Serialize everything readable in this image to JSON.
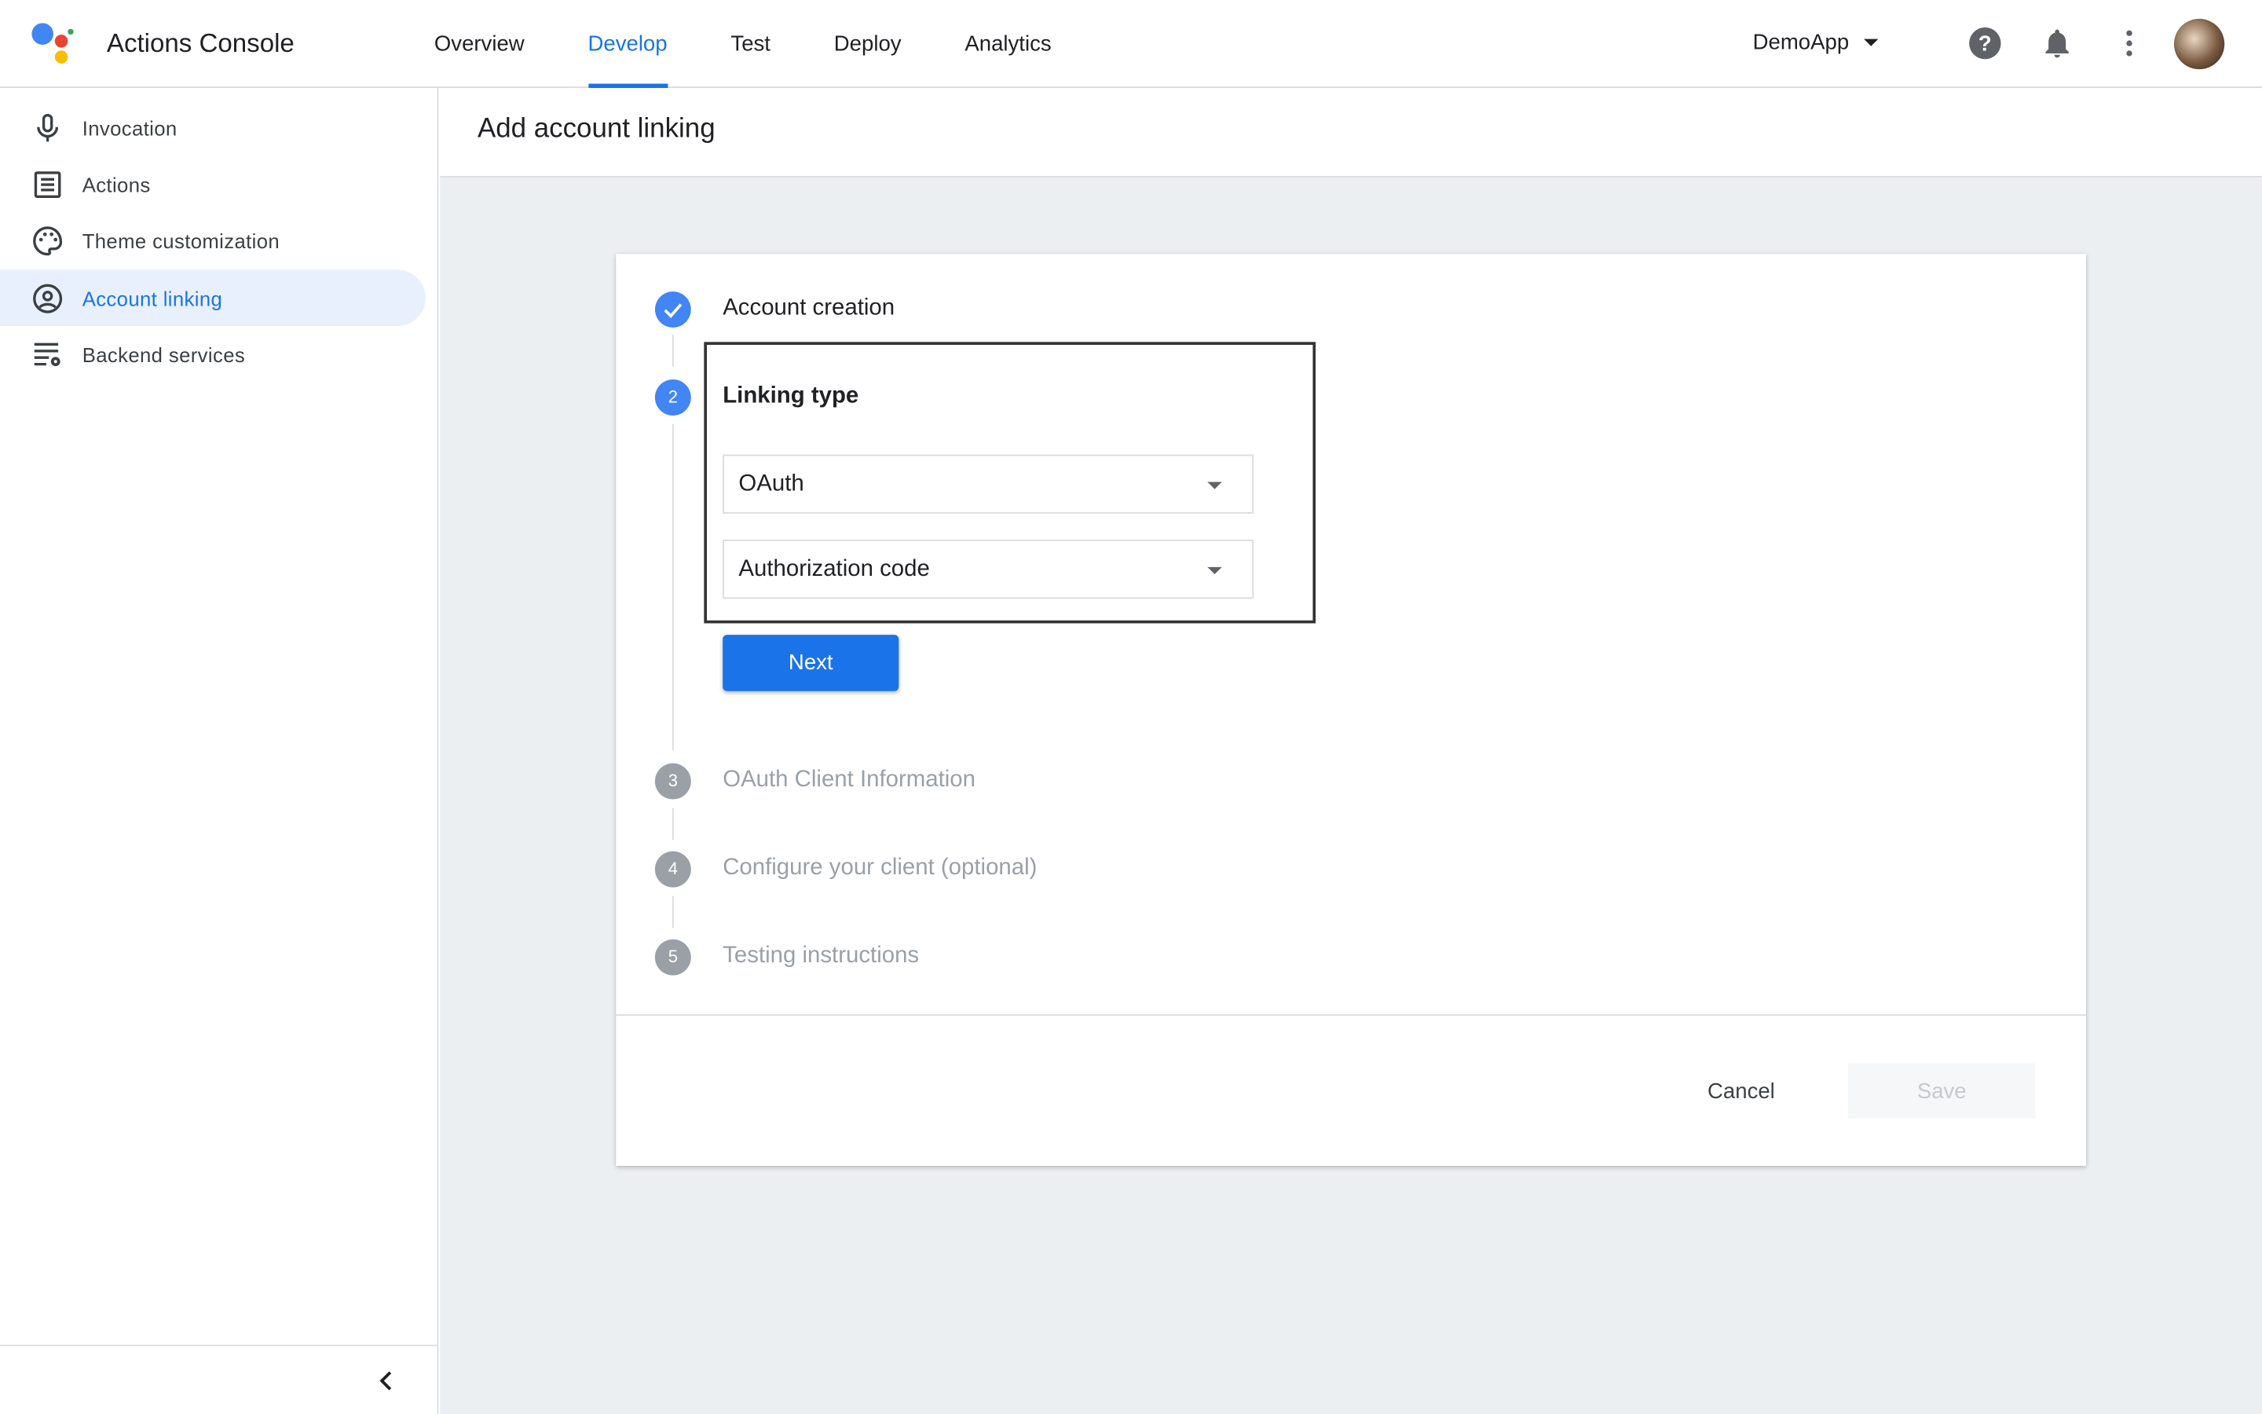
{
  "app": {
    "title": "Actions Console",
    "brand_colors": [
      "#4285f4",
      "#ea4335",
      "#fbbc04",
      "#34a853"
    ]
  },
  "nav": {
    "tabs": [
      {
        "label": "Overview"
      },
      {
        "label": "Develop",
        "active": true
      },
      {
        "label": "Test"
      },
      {
        "label": "Deploy"
      },
      {
        "label": "Analytics"
      }
    ]
  },
  "header": {
    "project": "DemoApp",
    "icons": [
      "help-icon",
      "bell-icon",
      "more-vert-icon",
      "avatar"
    ]
  },
  "sidebar": {
    "items": [
      {
        "label": "Invocation",
        "icon": "mic-icon"
      },
      {
        "label": "Actions",
        "icon": "list-icon"
      },
      {
        "label": "Theme customization",
        "icon": "palette-icon"
      },
      {
        "label": "Account linking",
        "icon": "account-circle-icon",
        "active": true
      },
      {
        "label": "Backend services",
        "icon": "settings-list-icon"
      }
    ]
  },
  "page": {
    "title": "Add account linking"
  },
  "steps": [
    {
      "number": "1",
      "title": "Account creation",
      "status": "done"
    },
    {
      "number": "2",
      "title": "Linking type",
      "status": "active"
    },
    {
      "number": "3",
      "title": "OAuth Client Information",
      "status": "pending"
    },
    {
      "number": "4",
      "title": "Configure your client (optional)",
      "status": "pending"
    },
    {
      "number": "5",
      "title": "Testing instructions",
      "status": "pending"
    }
  ],
  "linking": {
    "type_select": "OAuth",
    "grant_select": "Authorization code",
    "next_label": "Next"
  },
  "footer": {
    "cancel_label": "Cancel",
    "save_label": "Save"
  },
  "colors": {
    "accent": "#1a73e8",
    "background": "#eceff1",
    "pending_step": "#9aa0a6"
  }
}
